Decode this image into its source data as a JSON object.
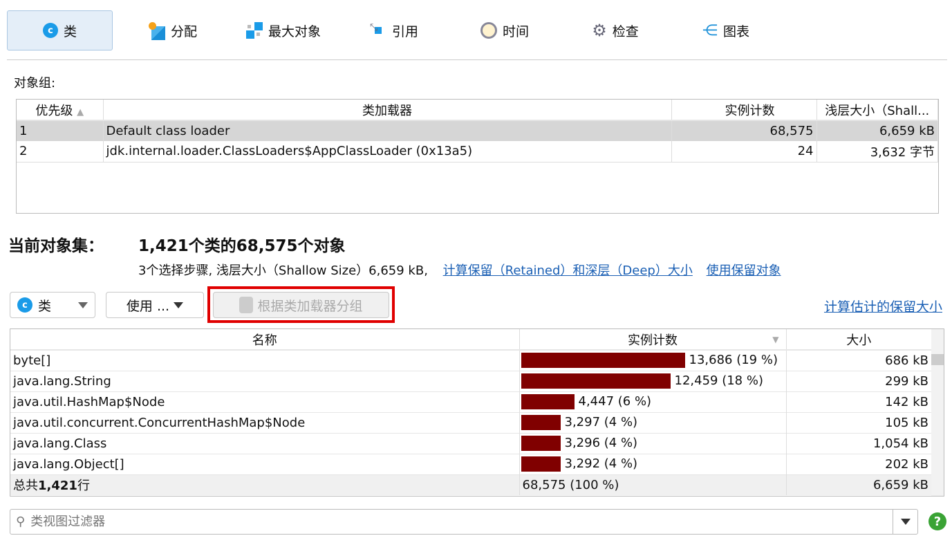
{
  "tabs": [
    {
      "label": "类",
      "icon": "class-icon",
      "active": true
    },
    {
      "label": "分配",
      "icon": "allocation-icon"
    },
    {
      "label": "最大对象",
      "icon": "biggest-objects-icon"
    },
    {
      "label": "引用",
      "icon": "references-icon"
    },
    {
      "label": "时间",
      "icon": "clock-icon"
    },
    {
      "label": "检查",
      "icon": "gear-icon"
    },
    {
      "label": "图表",
      "icon": "graph-icon"
    }
  ],
  "object_groups": {
    "label": "对象组:",
    "columns": [
      "优先级",
      "类加载器",
      "实例计数",
      "浅层大小（Shall..."
    ],
    "rows": [
      [
        "1",
        "Default class loader",
        "68,575",
        "6,659 kB"
      ],
      [
        "2",
        "jdk.internal.loader.ClassLoaders$AppClassLoader (0x13a5)",
        "24",
        "3,632 字节"
      ]
    ]
  },
  "current": {
    "label": "当前对象集：",
    "summary": "1,421个类的68,575个对象",
    "details": "3个选择步骤, 浅层大小（Shallow Size）6,659 kB,",
    "link_retained": "计算保留（Retained）和深层（Deep）大小",
    "link_use_retained": "使用保留对象"
  },
  "toolbar": {
    "view_select": "类",
    "use_menu": "使用 ...",
    "group_by_loader": "根据类加载器分组",
    "estimate_link": "计算估计的保留大小"
  },
  "classes": {
    "columns": [
      "名称",
      "实例计数",
      "大小"
    ],
    "max_count": 13686,
    "rows": [
      {
        "name": "byte[]",
        "count": 13686,
        "count_label": "13,686 (19 %)",
        "size": "686 kB"
      },
      {
        "name": "java.lang.String",
        "count": 12459,
        "count_label": "12,459 (18 %)",
        "size": "299 kB"
      },
      {
        "name": "java.util.HashMap$Node",
        "count": 4447,
        "count_label": "4,447 (6 %)",
        "size": "142 kB"
      },
      {
        "name": "java.util.concurrent.ConcurrentHashMap$Node",
        "count": 3297,
        "count_label": "3,297 (4 %)",
        "size": "105 kB"
      },
      {
        "name": "java.lang.Class",
        "count": 3296,
        "count_label": "3,296 (4 %)",
        "size": "1,054 kB"
      },
      {
        "name": "java.lang.Object[]",
        "count": 3292,
        "count_label": "3,292 (4 %)",
        "size": "202 kB"
      }
    ],
    "total": {
      "label_prefix": "总共",
      "label_count": "1,421",
      "label_suffix": "行",
      "count": "68,575 (100 %)",
      "size": "6,659 kB"
    }
  },
  "filter": {
    "placeholder": "类视图过滤器"
  },
  "colors": {
    "bar": "#800000",
    "link": "#1a5fb4",
    "highlight": "#e00000"
  }
}
